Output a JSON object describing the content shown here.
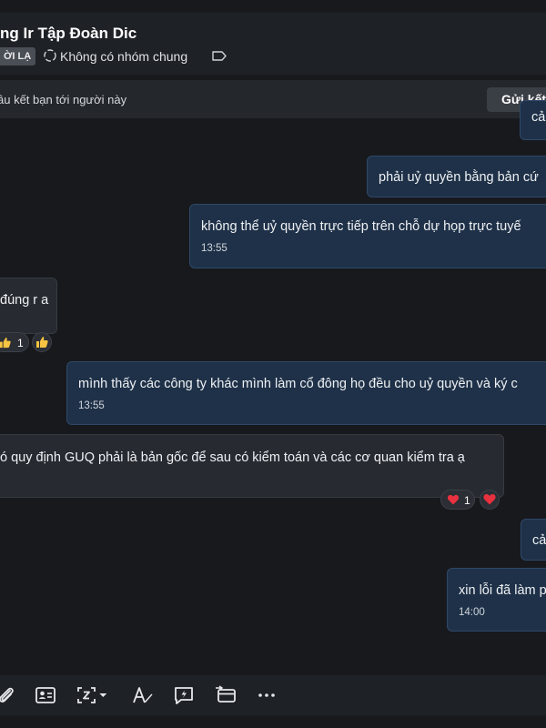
{
  "header": {
    "title": "ng Ir Tập Đoàn Dic",
    "badge": "ỜI LẠ",
    "groups_text": "Không có nhóm chung"
  },
  "friend_request": {
    "text": "âu kết bạn tới người này",
    "button_label": "Gửi kết"
  },
  "messages": [
    {
      "direction": "out",
      "text": "cả"
    },
    {
      "direction": "out",
      "text": "phải uỷ quyền bằng bản cứ"
    },
    {
      "direction": "out",
      "text": "không thể uỷ quyền trực tiếp trên chỗ dự họp trực tuyế",
      "time": "13:55"
    },
    {
      "direction": "in",
      "text": "đúng r a",
      "reactions": [
        {
          "emoji": "thumbs-up",
          "count": "1"
        }
      ]
    },
    {
      "direction": "out",
      "text": "mình thấy các công ty khác mình làm cổ đông họ đều cho uỷ quyền và ký c",
      "time": "13:55"
    },
    {
      "direction": "in",
      "text": "ó quy định GUQ phải là bản gốc để sau có kiểm toán và các cơ quan kiểm tra ạ",
      "reactions": [
        {
          "emoji": "heart",
          "count": "1"
        }
      ]
    },
    {
      "direction": "out",
      "text": "cả"
    },
    {
      "direction": "out",
      "text": "xin lỗi đã làm p",
      "time": "14:00"
    }
  ],
  "toolbar": {
    "items": [
      "attach-icon",
      "contact-card-icon",
      "screenshot-icon",
      "dropdown-arrow-icon",
      "text-format-icon",
      "quick-message-icon",
      "card-transfer-icon",
      "more-icon"
    ]
  },
  "colors": {
    "background": "#17191d",
    "outgoing_bubble": "#1f3148",
    "incoming_bubble": "#272a30",
    "heart": "#e8313f",
    "thumb": "#f6c342"
  }
}
